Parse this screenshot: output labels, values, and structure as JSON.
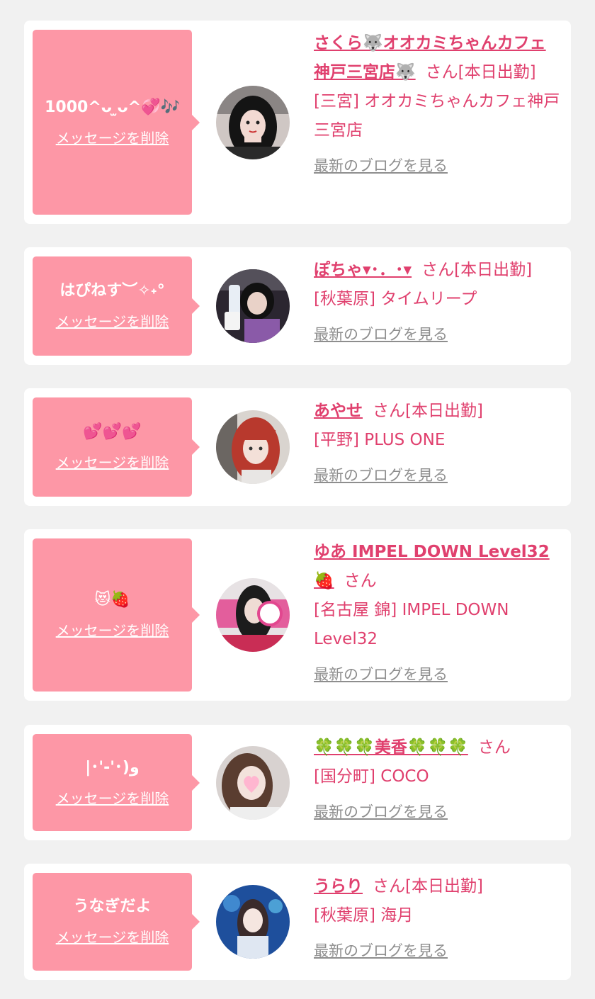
{
  "delete_label": "メッセージを削除",
  "blog_label": "最新のブログを見る",
  "san_label": "さん",
  "accent_color": "#e0406e",
  "bubble_color": "#fd97a6",
  "link_gray": "#8e8e8e",
  "items": [
    {
      "message": "1000^ᴗ ̫ᴗ^💞🎶",
      "name": "さくら🐺オオカミちゃんカフェ神戸三宮店🐺",
      "status": "[本日出勤]",
      "shop": "[三宮] オオカミちゃんカフェ神戸三宮店"
    },
    {
      "message": "はぴねす︶✧˖°",
      "name": "ぽちゃ▾･．･▾",
      "status": "[本日出勤]",
      "shop": "[秋葉原] タイムリープ"
    },
    {
      "message": "💕💕💕",
      "name": "あやせ",
      "status": "[本日出勤]",
      "shop": "[平野] PLUS ONE"
    },
    {
      "message": "😻🍓",
      "name": "ゆあ IMPEL DOWN Level32 🍓",
      "status": "",
      "shop": "[名古屋 錦] IMPEL DOWN Level32"
    },
    {
      "message": "|･'-'･)و",
      "name": "🍀🍀🍀美香🍀🍀🍀",
      "status": "",
      "shop": "[国分町] COCO"
    },
    {
      "message": "うなぎだよ",
      "name": "うらり",
      "status": "[本日出勤]",
      "shop": "[秋葉原] 海月"
    }
  ]
}
